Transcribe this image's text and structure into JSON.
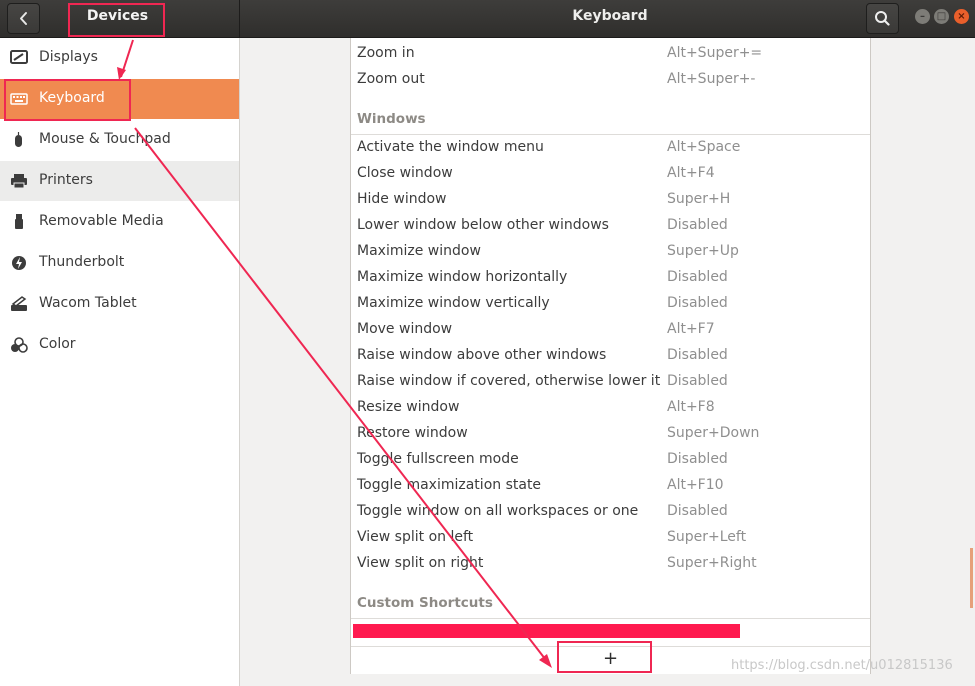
{
  "header": {
    "left_title": "Devices",
    "title": "Keyboard"
  },
  "sidebar": {
    "items": [
      {
        "label": "Displays",
        "icon": "display-icon"
      },
      {
        "label": "Keyboard",
        "icon": "keyboard-icon",
        "active": true
      },
      {
        "label": "Mouse & Touchpad",
        "icon": "mouse-icon"
      },
      {
        "label": "Printers",
        "icon": "printer-icon",
        "hover": true
      },
      {
        "label": "Removable Media",
        "icon": "usb-icon"
      },
      {
        "label": "Thunderbolt",
        "icon": "thunderbolt-icon"
      },
      {
        "label": "Wacom Tablet",
        "icon": "tablet-icon"
      },
      {
        "label": "Color",
        "icon": "color-icon"
      }
    ]
  },
  "shortcuts": {
    "zoom_rows": [
      {
        "name": "Zoom in",
        "accel": "Alt+Super+="
      },
      {
        "name": "Zoom out",
        "accel": "Alt+Super+-"
      }
    ],
    "windows_title": "Windows",
    "windows_rows": [
      {
        "name": "Activate the window menu",
        "accel": "Alt+Space"
      },
      {
        "name": "Close window",
        "accel": "Alt+F4"
      },
      {
        "name": "Hide window",
        "accel": "Super+H"
      },
      {
        "name": "Lower window below other windows",
        "accel": "Disabled"
      },
      {
        "name": "Maximize window",
        "accel": "Super+Up"
      },
      {
        "name": "Maximize window horizontally",
        "accel": "Disabled"
      },
      {
        "name": "Maximize window vertically",
        "accel": "Disabled"
      },
      {
        "name": "Move window",
        "accel": "Alt+F7"
      },
      {
        "name": "Raise window above other windows",
        "accel": "Disabled"
      },
      {
        "name": "Raise window if covered, otherwise lower it",
        "accel": "Disabled"
      },
      {
        "name": "Resize window",
        "accel": "Alt+F8"
      },
      {
        "name": "Restore window",
        "accel": "Super+Down"
      },
      {
        "name": "Toggle fullscreen mode",
        "accel": "Disabled"
      },
      {
        "name": "Toggle maximization state",
        "accel": "Alt+F10"
      },
      {
        "name": "Toggle window on all workspaces or one",
        "accel": "Disabled"
      },
      {
        "name": "View split on left",
        "accel": "Super+Left"
      },
      {
        "name": "View split on right",
        "accel": "Super+Right"
      }
    ],
    "custom_title": "Custom Shortcuts",
    "add_label": "+"
  },
  "watermark": "https://blog.csdn.net/u012815136",
  "colors": {
    "accent": "#f08a50",
    "annotation": "#ef2752",
    "close": "#e95f2b"
  }
}
